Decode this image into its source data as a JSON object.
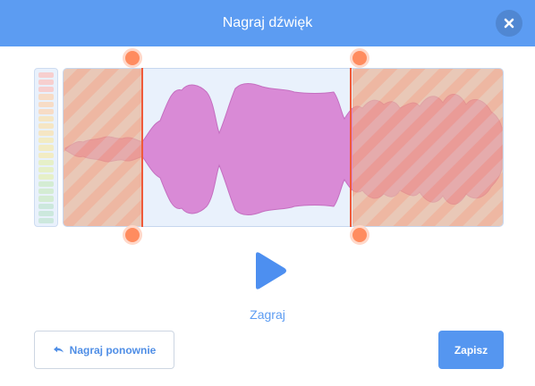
{
  "dialog": {
    "title": "Nagraj dźwięk",
    "close_icon": "close-icon"
  },
  "meter": {
    "level_colors": [
      "#f7cfcf",
      "#f7dcc6",
      "#f5e6c4",
      "#f2ecc4",
      "#e6f0c8",
      "#d4ecd3",
      "#cce8dd"
    ]
  },
  "trim": {
    "start_fraction": 0.18,
    "end_fraction": 0.655
  },
  "colors": {
    "accent": "#5c9cf2",
    "waveform": "#d98ad6",
    "trim_overlay": "#f39a7a",
    "handle": "#ff8c5f"
  },
  "controls": {
    "play_icon": "play-icon",
    "play_label": "Zagraj",
    "rerecord_icon": "undo-icon",
    "rerecord_label": "Nagraj ponownie",
    "save_label": "Zapisz"
  }
}
